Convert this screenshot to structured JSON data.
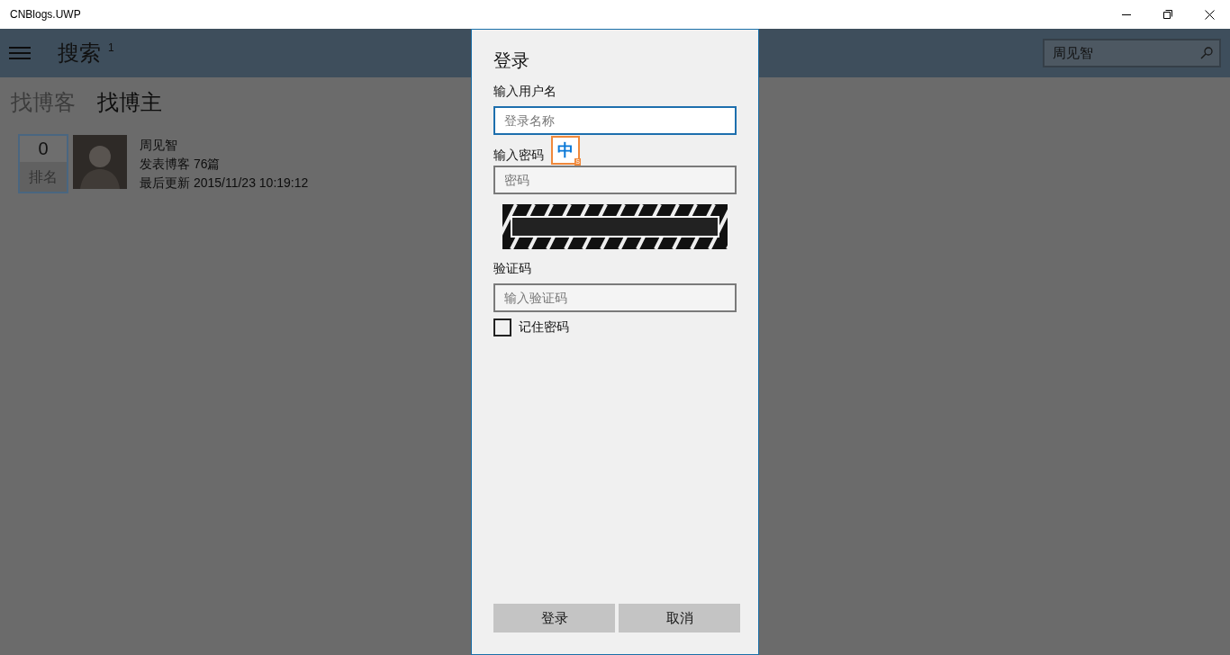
{
  "window": {
    "title": "CNBlogs.UWP"
  },
  "header": {
    "title": "搜索",
    "badge": "1",
    "search": {
      "value": "周见智"
    }
  },
  "tabs": [
    {
      "label": "找博客",
      "selected": false
    },
    {
      "label": "找博主",
      "selected": true
    }
  ],
  "results": [
    {
      "rank": "0",
      "rank_label": "排名",
      "name": "周见智",
      "posts": "发表博客 76篇",
      "updated": "最后更新 2015/11/23 10:19:12"
    }
  ],
  "dialog": {
    "title": "登录",
    "username_label": "输入用户名",
    "username": {
      "placeholder": "登录名称",
      "focused": true
    },
    "password_label": "输入密码",
    "password": {
      "placeholder": "密码"
    },
    "captcha_label": "验证码",
    "captcha_field": {
      "placeholder": "输入验证码"
    },
    "remember": {
      "label": "记住密码",
      "checked": false
    },
    "buttons": [
      "登录",
      "取消"
    ]
  },
  "ime_indicator": {
    "mode": "中",
    "badge": "S"
  }
}
